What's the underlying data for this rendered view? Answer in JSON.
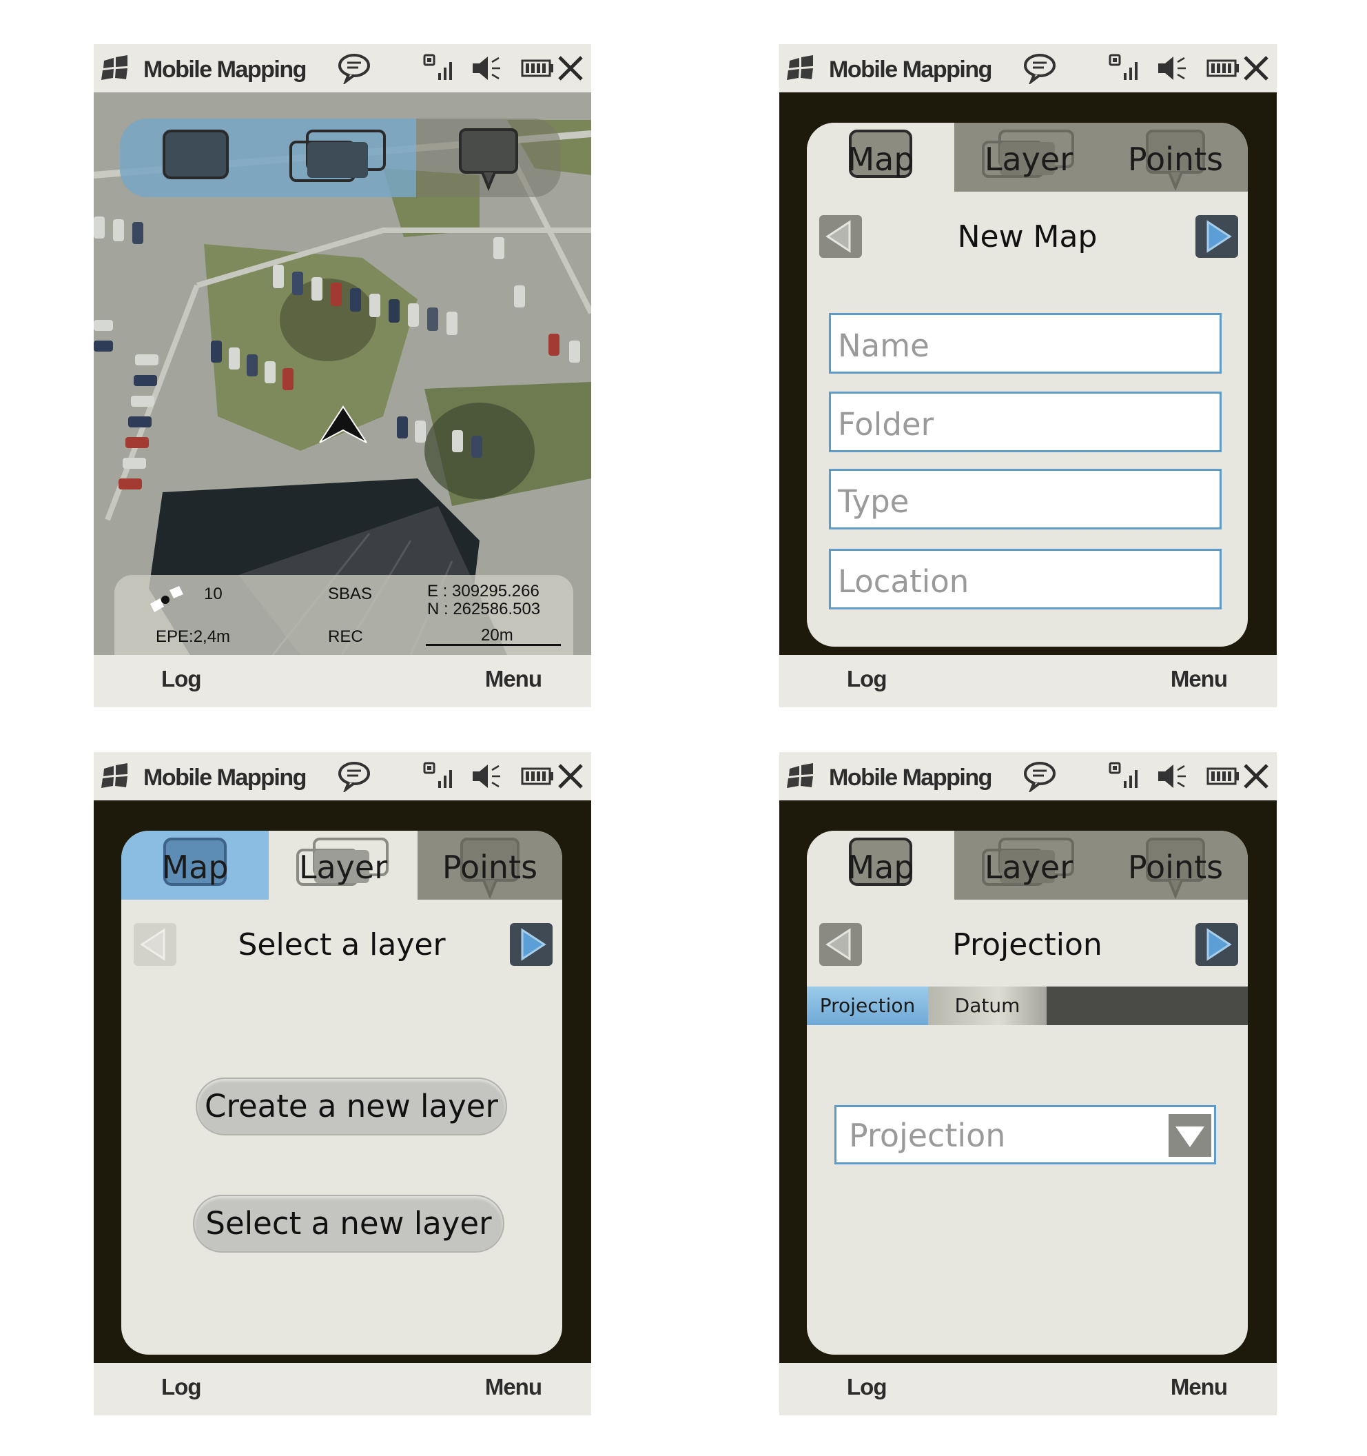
{
  "app": {
    "title": "Mobile Mapping"
  },
  "softkeys": {
    "left": "Log",
    "right": "Menu"
  },
  "tabs": {
    "map": "Map",
    "layer": "Layer",
    "points": "Points"
  },
  "screen1": {
    "gps": {
      "satellites": "10",
      "mode": "SBAS",
      "easting": "E : 309295.266",
      "northing": "N : 262586.503",
      "epe": "EPE:2,4m",
      "rec": "REC",
      "scale": "20m"
    }
  },
  "screen2": {
    "title": "New Map",
    "fields": {
      "name": "Name",
      "folder": "Folder",
      "type": "Type",
      "location": "Location"
    }
  },
  "screen3": {
    "title": "Select a layer",
    "create_button": "Create a new layer",
    "select_button": "Select a new layer"
  },
  "screen4": {
    "title": "Projection",
    "subtabs": {
      "projection": "Projection",
      "datum": "Datum"
    },
    "select_placeholder": "Projection"
  },
  "colors": {
    "accent_blue": "#8bbde2",
    "field_border": "#5f9bc9",
    "frame": "#1d1a0c"
  }
}
